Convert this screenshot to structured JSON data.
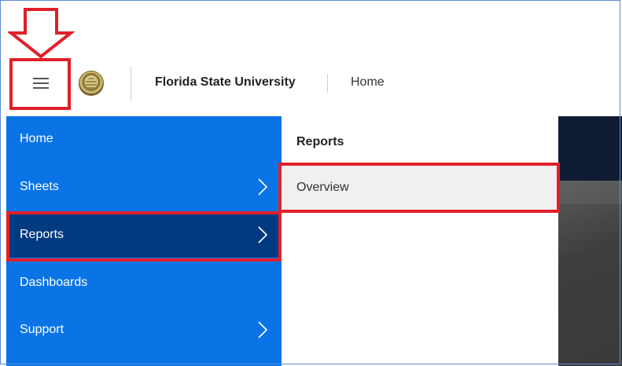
{
  "header": {
    "org_name": "Florida State University",
    "breadcrumb_home": "Home",
    "menu_icon": "hamburger-menu-icon",
    "logo_icon": "university-seal-icon"
  },
  "nav": {
    "items": [
      {
        "label": "Home",
        "has_submenu": false
      },
      {
        "label": "Sheets",
        "has_submenu": true
      },
      {
        "label": "Reports",
        "has_submenu": true,
        "selected": true
      },
      {
        "label": "Dashboards",
        "has_submenu": false
      },
      {
        "label": "Support",
        "has_submenu": true
      }
    ]
  },
  "submenu": {
    "title": "Reports",
    "items": [
      {
        "label": "Overview"
      }
    ]
  },
  "colors": {
    "nav_blue": "#0a74e6",
    "nav_selected": "#013a80",
    "annotation_red": "#e0202a",
    "dark_content": "#0f1c33"
  }
}
